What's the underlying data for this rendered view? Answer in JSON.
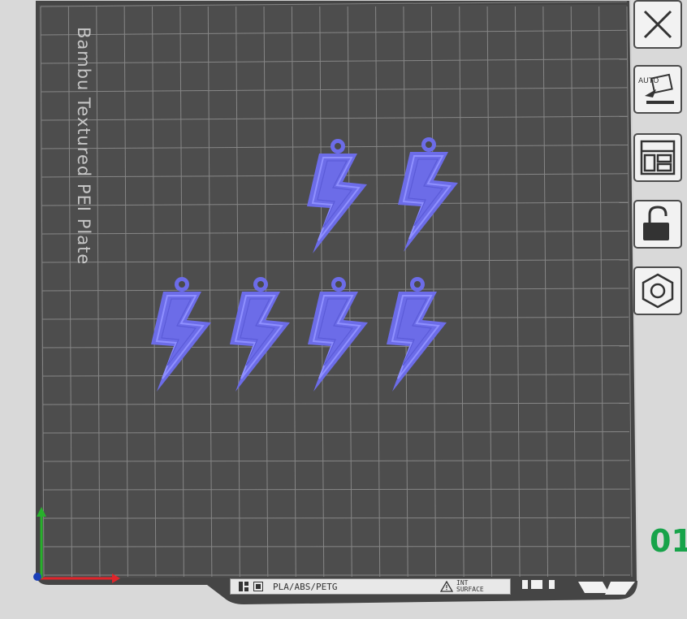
{
  "plate": {
    "name_label": "Bambu Textured PEI Plate",
    "plate_number": "01",
    "material_label": "PLA/ABS/PETG",
    "surface_label": [
      "INT",
      "SURFACE"
    ],
    "object_color": "#7b7cf4",
    "bed_color": "#4a4a4a"
  },
  "toolbar": {
    "buttons": [
      {
        "name": "close-button",
        "icon": "close-icon"
      },
      {
        "name": "auto-arrange-button",
        "icon": "auto-orient-icon",
        "text": "AUTO"
      },
      {
        "name": "arrange-layout-button",
        "icon": "layout-icon"
      },
      {
        "name": "lock-plate-button",
        "icon": "lock-icon"
      },
      {
        "name": "plate-settings-button",
        "icon": "hex-nut-icon"
      }
    ]
  },
  "objects": {
    "count": 6,
    "shape": "lightning-bolt-keychain"
  }
}
